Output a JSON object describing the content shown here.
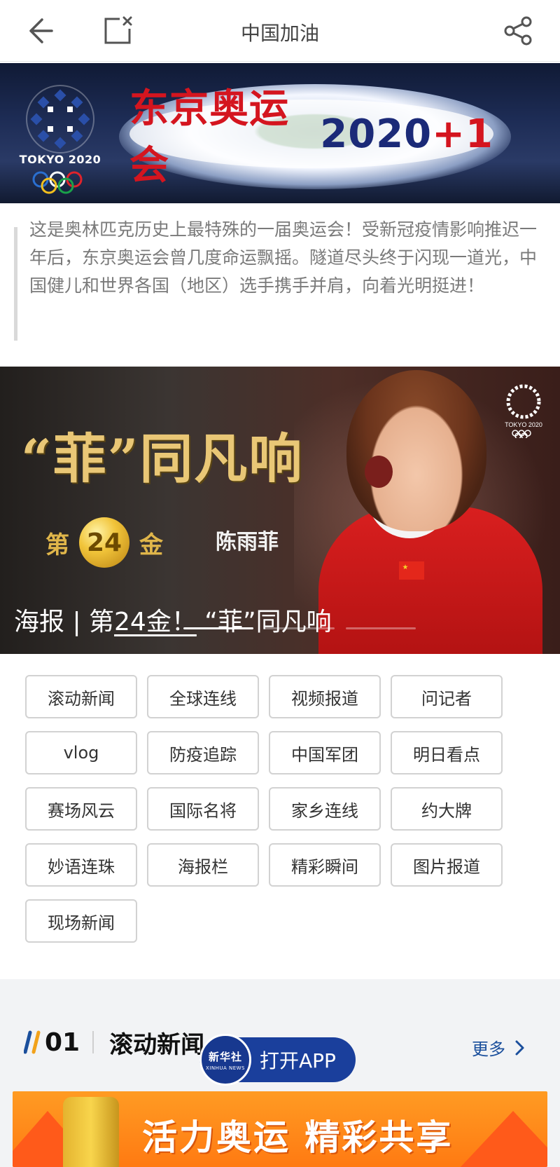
{
  "topbar": {
    "title": "中国加油",
    "back_icon": "back-arrow-icon",
    "close_icon": "close-page-icon",
    "share_icon": "share-icon"
  },
  "banner": {
    "title_cn": "东京奥运会",
    "title_num": "2020",
    "title_plus": "+1",
    "logo_text": "TOKYO 2020"
  },
  "intro": {
    "text": "这是奥林匹克历史上最特殊的一届奥运会！受新冠疫情影响推迟一年后，东京奥运会曾几度命运飘摇。隧道尽头终于闪现一道光，中国健儿和世界各国（地区）选手携手并肩，向着光明挺进！"
  },
  "poster": {
    "slogan": "“菲”同凡响",
    "gold_prefix": "第",
    "gold_number": "24",
    "gold_suffix": "金",
    "athlete": "陈雨菲",
    "logo_text": "TOKYO 2020",
    "caption_prefix": "海报 | 第",
    "caption_underlined": "24金！",
    "caption_suffix": " “菲”同凡响",
    "carousel_total": 3,
    "carousel_active": 1
  },
  "categories": [
    "滚动新闻",
    "全球连线",
    "视频报道",
    "问记者",
    "vlog",
    "防疫追踪",
    "中国军团",
    "明日看点",
    "赛场风云",
    "国际名将",
    "家乡连线",
    "约大牌",
    "妙语连珠",
    "海报栏",
    "精彩瞬间",
    "图片报道",
    "现场新闻"
  ],
  "section": {
    "number": "01",
    "title": "滚动新闻",
    "more_label": "更多"
  },
  "open_app": {
    "label": "打开APP",
    "logo_cn": "新华社",
    "logo_en": "XINHUA NEWS"
  },
  "ad": {
    "text": "活力奥运 精彩共享"
  },
  "colors": {
    "accent_blue": "#1a3f9c",
    "banner_red": "#d4151f",
    "ad_orange": "#ff8a1a"
  }
}
